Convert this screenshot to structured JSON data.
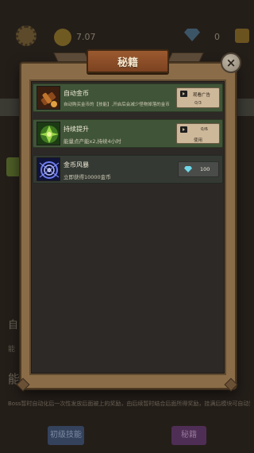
{
  "background": {
    "coins": "7.07",
    "gems": "0",
    "text_a": "自",
    "text_b": "能",
    "text_c": "能",
    "footnote": "Boss暂时自动化后一次性发放后面被上的奖励，由后续暂时结合后面所得奖励，挂满后模块可自动累计结束自动化后"
  },
  "modal": {
    "title": "秘籍",
    "close_glyph": "×"
  },
  "cheats": [
    {
      "title": "自动金币",
      "desc": "自动购买金币的【技能】,开启后会减少怪物掉落的金币",
      "button_label": "观看广告",
      "button_count": "0/3"
    },
    {
      "title": "持续提升",
      "desc": "能量点产能x2,持续4小时",
      "button_label": "0/6",
      "button_count": "使用"
    },
    {
      "title": "金币风暴",
      "desc": "立即获得10000金币",
      "cost": "100"
    }
  ],
  "bottom_buttons": {
    "left": "初级技能",
    "right": "秘籍"
  },
  "colors": {
    "row_active": "#405537",
    "row_inactive": "#343a33",
    "title_banner": "#9b5a30",
    "frame": "#8a6d48"
  },
  "icons": [
    "gear-icon",
    "coin-icon",
    "gem-icon",
    "plus-icon",
    "close-icon",
    "video-icon",
    "tree-icon",
    "vortex-icon"
  ]
}
